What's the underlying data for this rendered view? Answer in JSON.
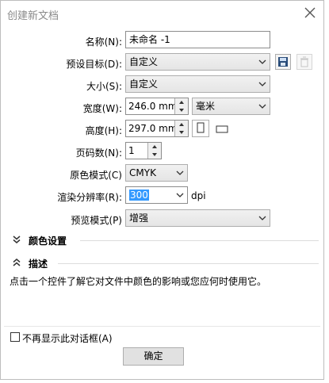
{
  "window": {
    "title": "创建新文档"
  },
  "fields": {
    "name": {
      "label": "名称(N):",
      "value": "未命名 -1"
    },
    "preset": {
      "label": "预设目标(D):",
      "value": "自定义"
    },
    "size": {
      "label": "大小(S):",
      "value": "自定义"
    },
    "width": {
      "label": "宽度(W):",
      "value": "246.0 mm",
      "unit": "毫米"
    },
    "height": {
      "label": "高度(H):",
      "value": "297.0 mm"
    },
    "pages": {
      "label": "页码数(N):",
      "value": "1"
    },
    "color_mode": {
      "label": "原色模式(C)",
      "value": "CMYK"
    },
    "resolution": {
      "label": "渲染分辨率(R):",
      "value": "300",
      "unit": "dpi"
    },
    "preview": {
      "label": "预览模式(P)",
      "value": "增强"
    }
  },
  "sections": {
    "color_settings": "颜色设置",
    "description": "描述"
  },
  "description_text": "点击一个控件了解它对文件中颜色的影响或您应何时使用它。",
  "dont_show": {
    "label": "不再显示此对话框(A)",
    "checked": false
  },
  "ok_label": "确定",
  "colors": {
    "selection": "#3399ff",
    "title_text": "#8a8a8a"
  }
}
